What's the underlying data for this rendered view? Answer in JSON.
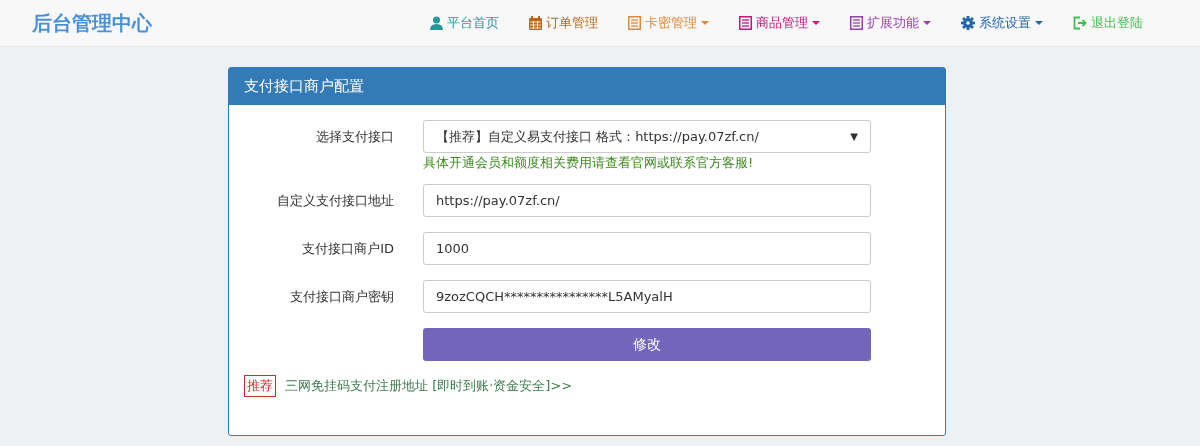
{
  "brand": "后台管理中心",
  "nav": [
    {
      "label": "平台首页",
      "kind": "user",
      "color": "#23999a",
      "dropdown": false
    },
    {
      "label": "订单管理",
      "kind": "calendar",
      "color": "#b86a1c",
      "dropdown": false
    },
    {
      "label": "卡密管理",
      "kind": "list",
      "color": "#e0883a",
      "dropdown": true
    },
    {
      "label": "商品管理",
      "kind": "list",
      "color": "#c2177f",
      "dropdown": true
    },
    {
      "label": "扩展功能",
      "kind": "list",
      "color": "#9a3fb0",
      "dropdown": true
    },
    {
      "label": "系统设置",
      "kind": "gear",
      "color": "#1f66ad",
      "dropdown": true
    },
    {
      "label": "退出登陆",
      "kind": "exit",
      "color": "#3fbf4f",
      "dropdown": false
    }
  ],
  "panel": {
    "title": "支付接口商户配置",
    "fields": [
      {
        "kind": "select",
        "label": "选择支付接口",
        "value": "【推荐】自定义易支付接口 格式：https://pay.07zf.cn/",
        "arrow": "▼",
        "help": "具体开通会员和额度相关费用请查看官网或联系官方客服!"
      },
      {
        "kind": "text",
        "label": "自定义支付接口地址",
        "value": "https://pay.07zf.cn/"
      },
      {
        "kind": "text",
        "label": "支付接口商户ID",
        "value": "1000"
      },
      {
        "kind": "text",
        "label": "支付接口商户密钥",
        "value": "9zozCQCH****************L5AMyalH"
      }
    ],
    "submit": "修改",
    "promo": {
      "badge": "推荐",
      "link": "三网免挂码支付注册地址 [即时到账·资金安全]>>"
    }
  }
}
